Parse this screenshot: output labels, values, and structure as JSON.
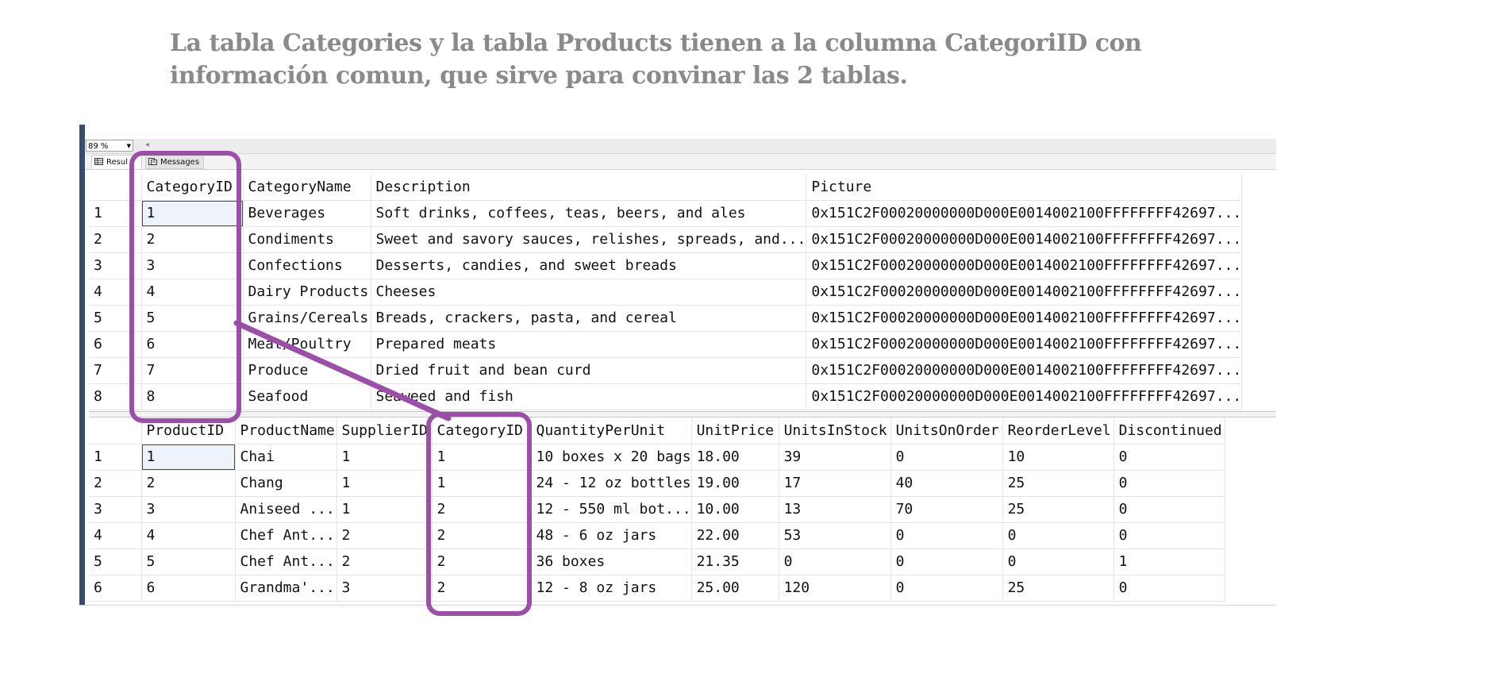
{
  "heading": {
    "line1": "La tabla Categories y la tabla Products tienen a la columna CategoriID con",
    "line2": "información comun, que sirve para convinar las 2 tablas."
  },
  "toolbar": {
    "zoom_value": "89 %"
  },
  "tabs": {
    "results": "Resul",
    "messages": "Messages"
  },
  "categories": {
    "columns": [
      "",
      "CategoryID",
      "CategoryName",
      "Description",
      "Picture"
    ],
    "rows": [
      [
        "1",
        "1",
        "Beverages",
        "Soft drinks, coffees, teas, beers, and ales",
        "0x151C2F00020000000D000E0014002100FFFFFFFF42697..."
      ],
      [
        "2",
        "2",
        "Condiments",
        "Sweet and savory sauces, relishes, spreads, and...",
        "0x151C2F00020000000D000E0014002100FFFFFFFF42697..."
      ],
      [
        "3",
        "3",
        "Confections",
        "Desserts, candies, and sweet breads",
        "0x151C2F00020000000D000E0014002100FFFFFFFF42697..."
      ],
      [
        "4",
        "4",
        "Dairy Products",
        "Cheeses",
        "0x151C2F00020000000D000E0014002100FFFFFFFF42697..."
      ],
      [
        "5",
        "5",
        "Grains/Cereals",
        "Breads, crackers, pasta, and cereal",
        "0x151C2F00020000000D000E0014002100FFFFFFFF42697..."
      ],
      [
        "6",
        "6",
        "Meat/Poultry",
        "Prepared meats",
        "0x151C2F00020000000D000E0014002100FFFFFFFF42697..."
      ],
      [
        "7",
        "7",
        "Produce",
        "Dried fruit and bean curd",
        "0x151C2F00020000000D000E0014002100FFFFFFFF42697..."
      ],
      [
        "8",
        "8",
        "Seafood",
        "Seaweed and fish",
        "0x151C2F00020000000D000E0014002100FFFFFFFF42697..."
      ]
    ]
  },
  "products": {
    "columns": [
      "",
      "ProductID",
      "ProductName",
      "SupplierID",
      "CategoryID",
      "QuantityPerUnit",
      "UnitPrice",
      "UnitsInStock",
      "UnitsOnOrder",
      "ReorderLevel",
      "Discontinued"
    ],
    "rows": [
      [
        "1",
        "1",
        "Chai",
        "1",
        "1",
        "10 boxes x 20 bags",
        "18.00",
        "39",
        "0",
        "10",
        "0"
      ],
      [
        "2",
        "2",
        "Chang",
        "1",
        "1",
        "24 - 12 oz bottles",
        "19.00",
        "17",
        "40",
        "25",
        "0"
      ],
      [
        "3",
        "3",
        "Aniseed ...",
        "1",
        "2",
        "12 - 550 ml bot...",
        "10.00",
        "13",
        "70",
        "25",
        "0"
      ],
      [
        "4",
        "4",
        "Chef Ant...",
        "2",
        "2",
        "48 - 6 oz jars",
        "22.00",
        "53",
        "0",
        "0",
        "0"
      ],
      [
        "5",
        "5",
        "Chef Ant...",
        "2",
        "2",
        "36 boxes",
        "21.35",
        "0",
        "0",
        "0",
        "1"
      ],
      [
        "6",
        "6",
        "Grandma'...",
        "3",
        "2",
        "12 - 8 oz jars",
        "25.00",
        "120",
        "0",
        "25",
        "0"
      ]
    ]
  },
  "colors": {
    "highlight": "#9b4fa8",
    "heading": "#8a8a8a"
  }
}
